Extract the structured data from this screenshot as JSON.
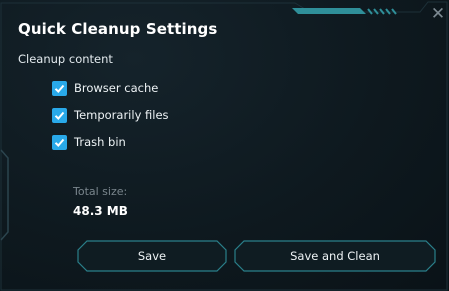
{
  "dialog": {
    "title": "Quick Cleanup Settings",
    "close_symbol": "✕",
    "section_label": "Cleanup content",
    "options": [
      {
        "label": "Browser cache",
        "checked": true
      },
      {
        "label": "Temporarily files",
        "checked": true
      },
      {
        "label": "Trash bin",
        "checked": true
      }
    ],
    "total_label": "Total size:",
    "total_value": "48.3 MB",
    "buttons": {
      "save": "Save",
      "save_and_clean": "Save and Clean"
    }
  },
  "colors": {
    "accent": "#29a9e9",
    "teal_frame": "#2a7f8a",
    "background": "#0e191f"
  }
}
